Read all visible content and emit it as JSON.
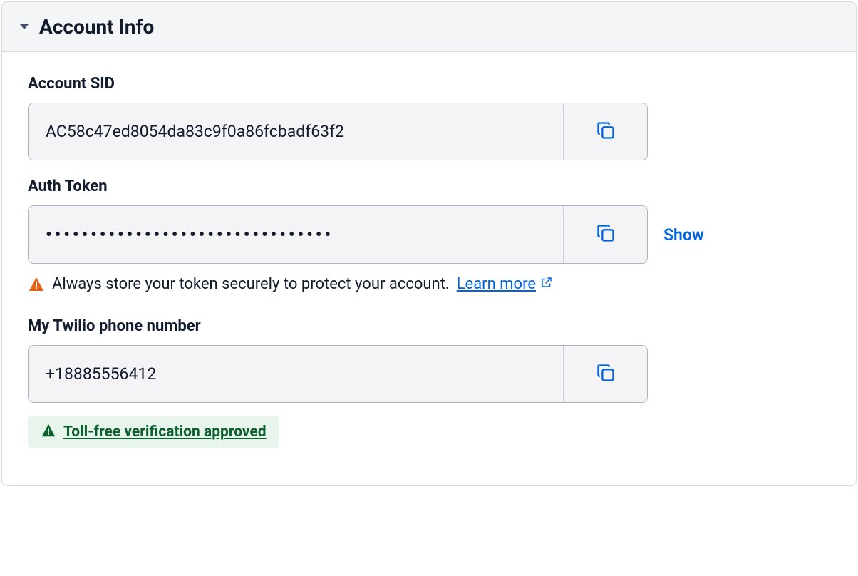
{
  "panel": {
    "title": "Account Info"
  },
  "account_sid": {
    "label": "Account SID",
    "value": "AC58c47ed8054da83c9f0a86fcbadf63f2"
  },
  "auth_token": {
    "label": "Auth Token",
    "masked_value": "••••••••••••••••••••••••••••••••",
    "show_label": "Show",
    "warning_text": "Always store your token securely to protect your account.",
    "learn_more_label": "Learn more"
  },
  "phone": {
    "label": "My Twilio phone number",
    "value": "+18885556412"
  },
  "verification_badge": {
    "text": "Toll-free verification approved"
  }
}
